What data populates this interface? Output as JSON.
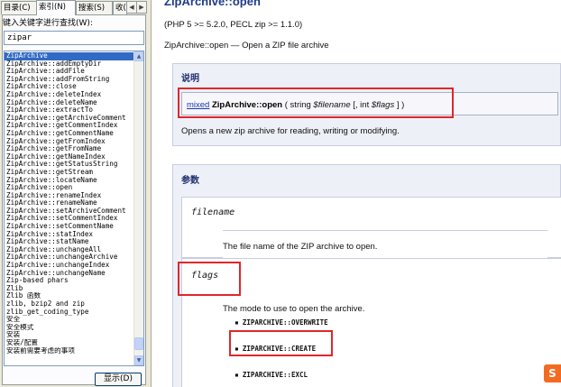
{
  "left_pane": {
    "tabs": [
      "目录(C)",
      "索引(N)",
      "搜索(S)",
      "收("
    ],
    "keyword_label": "键入关键字进行查找(W):",
    "keyword_value": "zipar",
    "index_items": [
      "ZipArchive",
      "ZipArchive::addEmptyDir",
      "ZipArchive::addFile",
      "ZipArchive::addFromString",
      "ZipArchive::close",
      "ZipArchive::deleteIndex",
      "ZipArchive::deleteName",
      "ZipArchive::extractTo",
      "ZipArchive::getArchiveComment",
      "ZipArchive::getCommentIndex",
      "ZipArchive::getCommentName",
      "ZipArchive::getFromIndex",
      "ZipArchive::getFromName",
      "ZipArchive::getNameIndex",
      "ZipArchive::getStatusString",
      "ZipArchive::getStream",
      "ZipArchive::locateName",
      "ZipArchive::open",
      "ZipArchive::renameIndex",
      "ZipArchive::renameName",
      "ZipArchive::setArchiveComment",
      "ZipArchive::setCommentIndex",
      "ZipArchive::setCommentName",
      "ZipArchive::statIndex",
      "ZipArchive::statName",
      "ZipArchive::unchangeAll",
      "ZipArchive::unchangeArchive",
      "ZipArchive::unchangeIndex",
      "ZipArchive::unchangeName",
      "Zip-based phars",
      "Zlib",
      "Zlib 函数",
      "zlib, bzip2 and zip",
      "zlib_get_coding_type",
      "安全",
      "安全模式",
      "安装",
      "安装/配置",
      "安装前需要考虑的事项"
    ],
    "selected_index": 0,
    "show_button": "显示(D)"
  },
  "doc": {
    "title": "ZipArchive::open",
    "versions": "(PHP 5 >= 5.2.0, PECL zip >= 1.1.0)",
    "summary": "ZipArchive::open — Open a ZIP file archive",
    "description_heading": "说明",
    "signature": {
      "return_type": "mixed",
      "method": "ZipArchive::open",
      "open": " ( string ",
      "param1": "$filename",
      "mid": " [, int ",
      "param2": "$flags",
      "close": " ] )"
    },
    "description_text": "Opens a new zip archive for reading, writing or modifying.",
    "parameters_heading": "参数",
    "filename": {
      "name": "filename",
      "desc": "The file name of the ZIP archive to open."
    },
    "flags": {
      "name": "flags",
      "desc": "The mode to use to open the archive.",
      "options": [
        "ZIPARCHIVE::OVERWRITE",
        "ZIPARCHIVE::CREATE",
        "ZIPARCHIVE::EXCL"
      ]
    }
  },
  "colors": {
    "highlight": "#e0262b",
    "selection": "#316ac5",
    "title": "#1f3a8a",
    "panel_bg": "#eef0f8"
  },
  "icons": {
    "scroll_up": "arrow-up-icon",
    "scroll_down": "arrow-down-icon",
    "tab_left": "arrow-left-icon",
    "tab_right": "arrow-right-icon",
    "brand": "sogou-s-icon"
  }
}
